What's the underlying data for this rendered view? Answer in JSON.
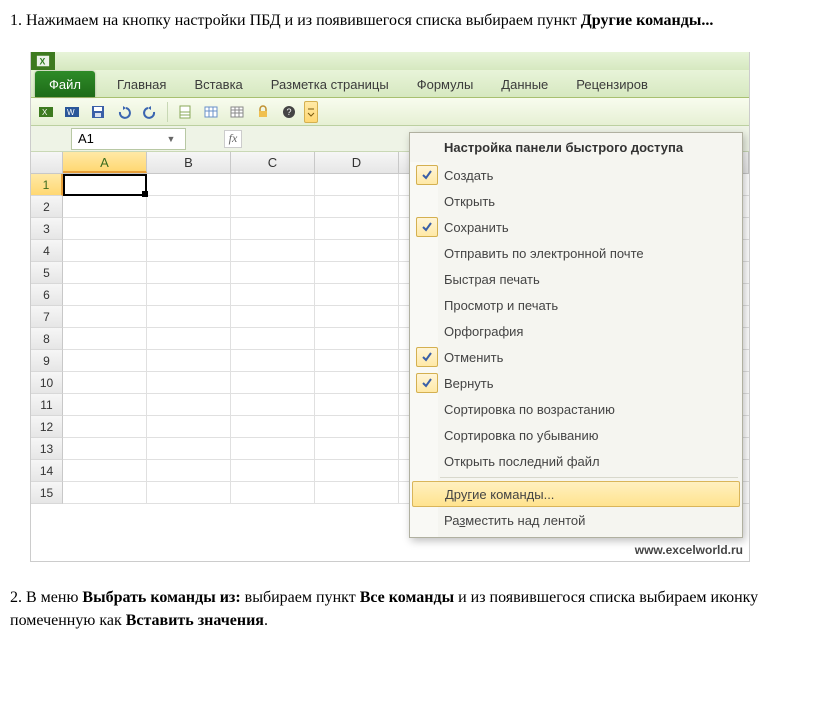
{
  "instructions": {
    "step1_prefix": "1. Нажимаем на кнопку настройки ПБД и из появившегося списка выбираем пункт ",
    "step1_bold": "Другие команды...",
    "step2_prefix": "2. В меню ",
    "step2_bold1": "Выбрать команды из:",
    "step2_mid": " выбираем пункт ",
    "step2_bold2": "Все команды",
    "step2_mid2": " и из появившегося списка выбираем иконку помеченную как ",
    "step2_bold3": "Вставить значения",
    "step2_suffix": "."
  },
  "excel": {
    "file_tab": "Файл",
    "tabs": [
      "Главная",
      "Вставка",
      "Разметка страницы",
      "Формулы",
      "Данные",
      "Рецензиров"
    ],
    "name_box": "A1",
    "fx": "fx",
    "columns": [
      "A",
      "B",
      "C",
      "D"
    ],
    "row_count": 15
  },
  "dropdown": {
    "title": "Настройка панели быстрого доступа",
    "items": [
      {
        "label": "Создать",
        "checked": true
      },
      {
        "label": "Открыть",
        "checked": false
      },
      {
        "label": "Сохранить",
        "checked": true
      },
      {
        "label": "Отправить по электронной почте",
        "checked": false
      },
      {
        "label": "Быстрая печать",
        "checked": false
      },
      {
        "label": "Просмотр и печать",
        "checked": false
      },
      {
        "label": "Орфография",
        "checked": false
      },
      {
        "label": "Отменить",
        "checked": true
      },
      {
        "label": "Вернуть",
        "checked": true
      },
      {
        "label": "Сортировка по возрастанию",
        "checked": false
      },
      {
        "label": "Сортировка по убыванию",
        "checked": false
      },
      {
        "label": "Открыть последний файл",
        "checked": false
      }
    ],
    "more_commands": "Другие команды...",
    "place_above": "Разместить над лентой"
  },
  "watermark": "www.excelworld.ru"
}
